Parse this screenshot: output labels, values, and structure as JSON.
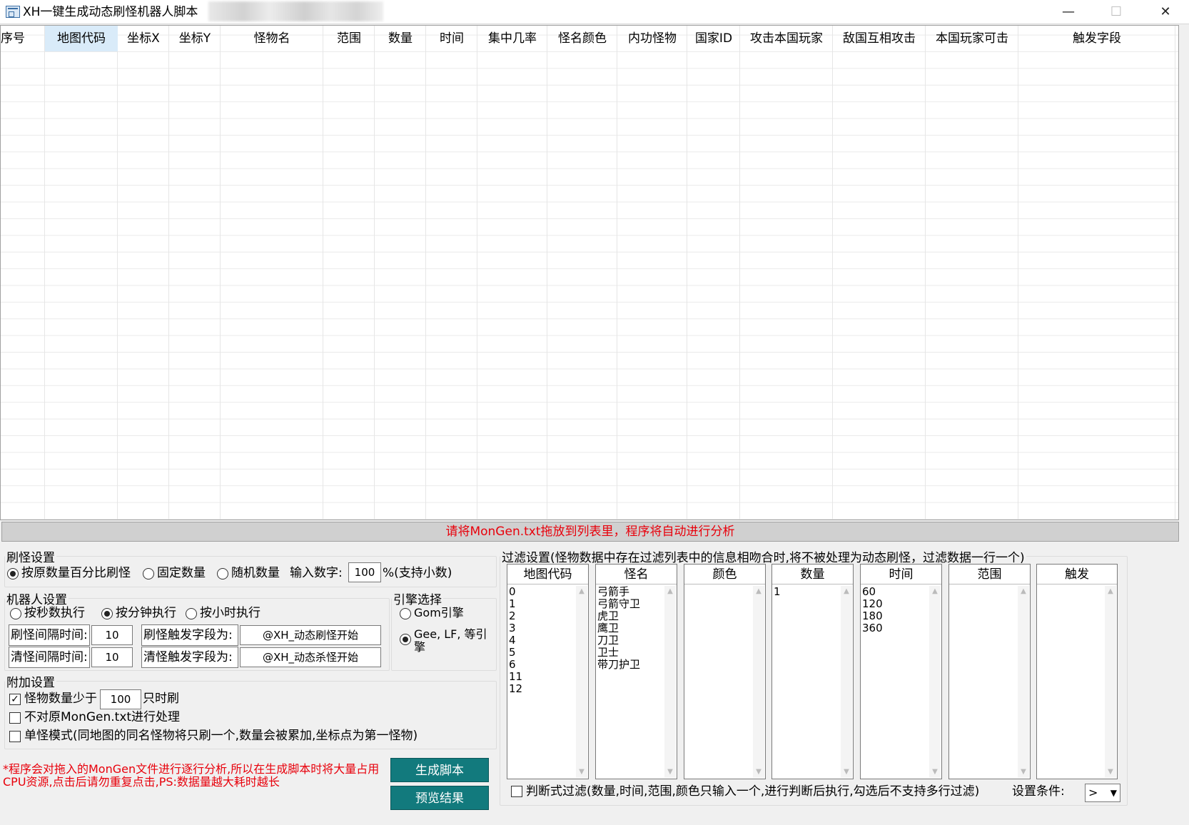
{
  "window": {
    "title": "XH一键生成动态刷怪机器人脚本",
    "min_glyph": "—",
    "max_glyph": "☐",
    "close_glyph": "✕"
  },
  "grid": {
    "columns": [
      "序号",
      "地图代码",
      "坐标X",
      "坐标Y",
      "怪物名",
      "范围",
      "数量",
      "时间",
      "集中几率",
      "怪名颜色",
      "内功怪物",
      "国家ID",
      "攻击本国玩家",
      "敌国互相攻击",
      "本国玩家可击",
      "触发字段"
    ],
    "selected_column": "地图代码"
  },
  "status": "请将MonGen.txt拖放到列表里，程序将自动进行分析",
  "spawn": {
    "title": "刷怪设置",
    "opt1": "按原数量百分比刷怪",
    "opt2": "固定数量",
    "opt3": "随机数量",
    "input_label": "输入数字:",
    "input_value": "100",
    "suffix": "%(支持小数)"
  },
  "robot": {
    "title": "机器人设置",
    "opt1": "按秒数执行",
    "opt2": "按分钟执行",
    "opt3": "按小时执行",
    "spawn_interval_label": "刷怪间隔时间:",
    "spawn_interval_value": "10",
    "spawn_trigger_label": "刷怪触发字段为:",
    "spawn_trigger_value": "@XH_动态刷怪开始",
    "clear_interval_label": "清怪间隔时间:",
    "clear_interval_value": "10",
    "clear_trigger_label": "清怪触发字段为:",
    "clear_trigger_value": "@XH_动态杀怪开始"
  },
  "engine": {
    "title": "引擎选择",
    "opt1": "Gom引擎",
    "opt2": "Gee, LF, 等引擎"
  },
  "extra": {
    "title": "附加设置",
    "chk1_pre": "怪物数量少于",
    "chk1_value": "100",
    "chk1_post": "只时刷",
    "chk2": "不对原MonGen.txt进行处理",
    "chk3": "单怪模式(同地图的同名怪物将只刷一个,数量会被累加,坐标点为第一怪物)"
  },
  "warning": "*程序会对拖入的MonGen文件进行逐行分析,所以在生成脚本时将大量占用CPU资源,点击后请勿重复点击,PS:数据量越大耗时越长",
  "buttons": {
    "generate": "生成脚本",
    "preview": "预览结果"
  },
  "filter": {
    "title": "过滤设置(怪物数据中存在过滤列表中的信息相吻合时,将不被处理为动态刷怪，过滤数据一行一个)",
    "columns": [
      {
        "header": "地图代码",
        "items": "0\n1\n2\n3\n4\n5\n6\n11\n12"
      },
      {
        "header": "怪名",
        "items": "弓箭手\n弓箭守卫\n虎卫\n鹰卫\n刀卫\n卫士\n带刀护卫"
      },
      {
        "header": "颜色",
        "items": ""
      },
      {
        "header": "数量",
        "items": "1"
      },
      {
        "header": "时间",
        "items": "60\n120\n180\n360"
      },
      {
        "header": "范围",
        "items": ""
      },
      {
        "header": "触发",
        "items": ""
      }
    ],
    "judge_label": "判断式过滤(数量,时间,范围,颜色只输入一个,进行判断后执行,勾选后不支持多行过滤)",
    "condition_label": "设置条件:",
    "condition_value": ">"
  }
}
